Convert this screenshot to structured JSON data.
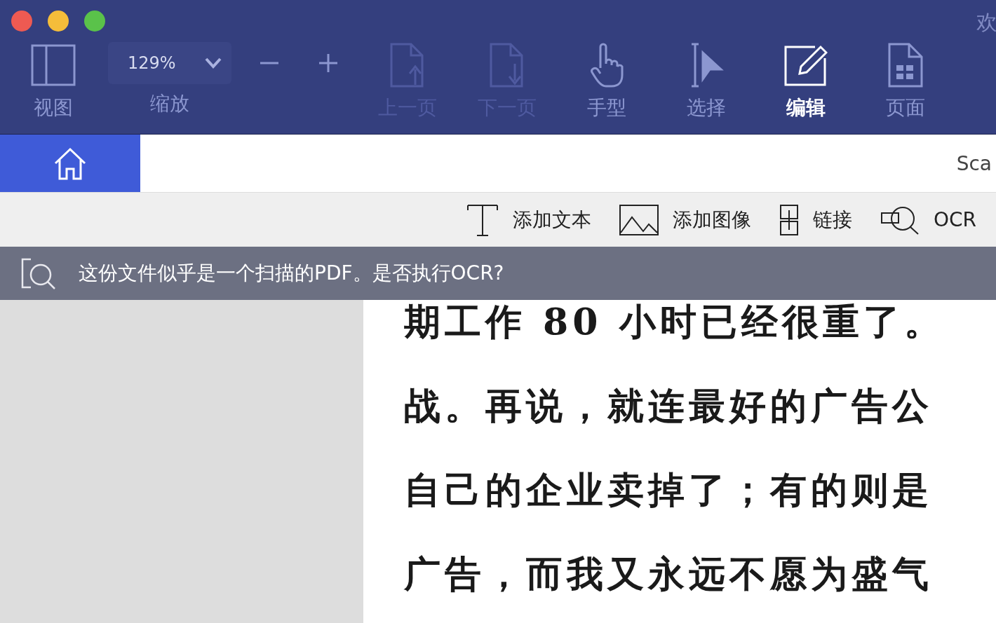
{
  "window": {
    "title": "欢"
  },
  "toolbar": [
    {
      "kind": "view",
      "label": "视图",
      "disabled": false,
      "selected": false
    },
    {
      "kind": "zoom",
      "value": "129%",
      "label": "缩放"
    },
    {
      "kind": "zoom-out",
      "disabled": false,
      "selected": false
    },
    {
      "kind": "zoom-in",
      "disabled": false,
      "selected": false
    },
    {
      "kind": "prev-page",
      "label": "上一页",
      "disabled": true,
      "selected": false
    },
    {
      "kind": "next-page",
      "label": "下一页",
      "disabled": true,
      "selected": false
    },
    {
      "kind": "hand",
      "label": "手型",
      "disabled": false,
      "selected": false
    },
    {
      "kind": "select",
      "label": "选择",
      "disabled": false,
      "selected": false
    },
    {
      "kind": "edit",
      "label": "编辑",
      "disabled": false,
      "selected": true
    },
    {
      "kind": "page",
      "label": "页面",
      "disabled": false,
      "selected": false
    }
  ],
  "tabs": [
    {
      "kind": "home",
      "selected": true
    },
    {
      "kind": "text",
      "label": "Sca",
      "selected": false
    }
  ],
  "edit_tools": [
    {
      "kind": "text",
      "label": "添加文本"
    },
    {
      "kind": "image",
      "label": "添加图像"
    },
    {
      "kind": "link",
      "label": "链接"
    },
    {
      "kind": "ocr",
      "label": "OCR"
    }
  ],
  "ocr_banner": {
    "message": "这份文件似乎是一个扫描的PDF。是否执行OCR?"
  },
  "document": {
    "lines": [
      "期工作 80 小时已经很重了。",
      "战。再说，就连最好的广告公",
      "自己的企业卖掉了；有的则是",
      "广告，而我又永远不愿为盛气"
    ]
  }
}
